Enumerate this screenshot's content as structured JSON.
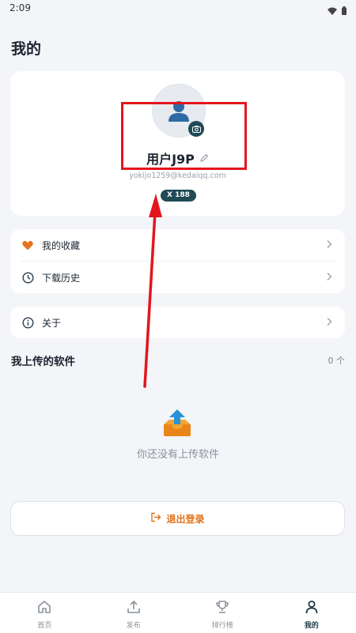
{
  "status_bar": {
    "time": "2:09"
  },
  "page": {
    "title": "我的"
  },
  "profile": {
    "username": "用户J9P",
    "email": "yokijo1259@kedaiqq.com",
    "points": "X 188"
  },
  "menu": {
    "items": [
      {
        "label": "我的收藏",
        "icon": "heart-icon"
      },
      {
        "label": "下载历史",
        "icon": "clock-icon"
      }
    ],
    "about": {
      "label": "关于",
      "icon": "info-icon"
    }
  },
  "uploads": {
    "title": "我上传的软件",
    "count": "0 个",
    "empty_text": "你还没有上传软件"
  },
  "logout": {
    "label": "退出登录"
  },
  "nav": [
    {
      "label": "首页",
      "icon": "home-icon"
    },
    {
      "label": "发布",
      "icon": "upload-icon"
    },
    {
      "label": "排行榜",
      "icon": "trophy-icon"
    },
    {
      "label": "我的",
      "icon": "person-icon",
      "active": true
    }
  ],
  "colors": {
    "accent": "#1f4a56",
    "heart": "#e8731f",
    "logout": "#e0731c",
    "annotation": "#e3161c"
  }
}
